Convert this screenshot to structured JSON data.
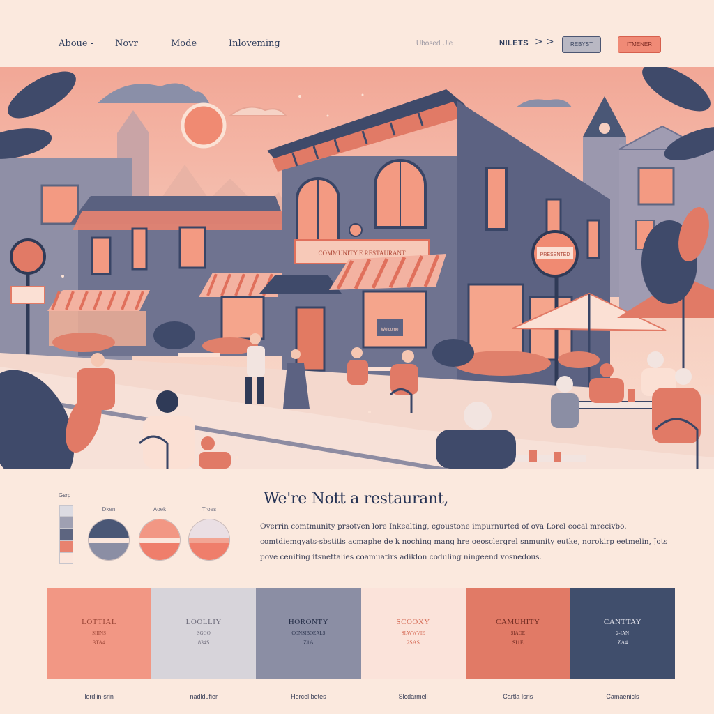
{
  "nav": {
    "items": [
      "Abouе -",
      "Novr",
      "Mode",
      "Inloveming"
    ],
    "muted_text": "Ubosed Ule",
    "nlets": "NILETS",
    "chevrons": [
      ">",
      ">"
    ],
    "button_secondary": "REBYST",
    "button_primary": "ITMENER"
  },
  "hero": {
    "sign_text": "COMMUNITY E RESTAURANT",
    "round_sign_text": "PRESENTED",
    "small_sign_text": "Welcome"
  },
  "palette": {
    "small_label": "Gsrp",
    "strip_colors": [
      "#dcdbe2",
      "#9fa0b2",
      "#5d6580",
      "#e8826f",
      "#fbe6dc"
    ],
    "circles": [
      {
        "label": "Dken",
        "top": "#4a5776",
        "mid": "#fbe6dc",
        "bottom": "#8b8ea4"
      },
      {
        "label": "Aoek",
        "top": "#f29784",
        "mid": "#fbe6dc",
        "bottom": "#ef7e6b"
      },
      {
        "label": "Troes",
        "top": "#eadfe4",
        "mid": "#f2a594",
        "bottom": "#ef7e6b"
      }
    ]
  },
  "intro": {
    "headline": "We're Nott a restaurant,",
    "lines": [
      "Overrin comtmunity prsotven lore Inkealting, egoustone impurnurted of ova Lorel eocal mrecivbo.",
      "comtdiemgyats-sbstitis acmaphe de k noching mang hre oeosclergrel snmunity eutke, norokirp eetmelin, Jots",
      "pove ceniting itsnettalies coamuatirs adiklon coduling ningeend vosnedous."
    ]
  },
  "cards": [
    {
      "title": "LOTTIAL",
      "sub": "SIIINS",
      "code": "3TA4",
      "bg": "#f29784",
      "fg": "#9a4536"
    },
    {
      "title": "LOOLLIY",
      "sub": "SGGO",
      "code": "834S",
      "bg": "#d7d4da",
      "fg": "#6d6b7a"
    },
    {
      "title": "HORONTY",
      "sub": "CONSIBOEALS",
      "code": "Z1A",
      "bg": "#8b8ea4",
      "fg": "#252e48"
    },
    {
      "title": "SCOOXY",
      "sub": "SIAVWVIE",
      "code": "2SAS",
      "bg": "#fbe3da",
      "fg": "#d56853"
    },
    {
      "title": "CAMUHITY",
      "sub": "SIAOE",
      "code": "SI1E",
      "bg": "#e17a66",
      "fg": "#6f2a21"
    },
    {
      "title": "CANTTAY",
      "sub": "2-IAN",
      "code": "ZA4",
      "bg": "#404e6c",
      "fg": "#e6e6ee"
    }
  ],
  "captions": [
    "lordiin-srin",
    "nadldufier",
    "Hercel betes",
    "Slcdarmell",
    "Cartla Isris",
    "Camaenicls"
  ]
}
